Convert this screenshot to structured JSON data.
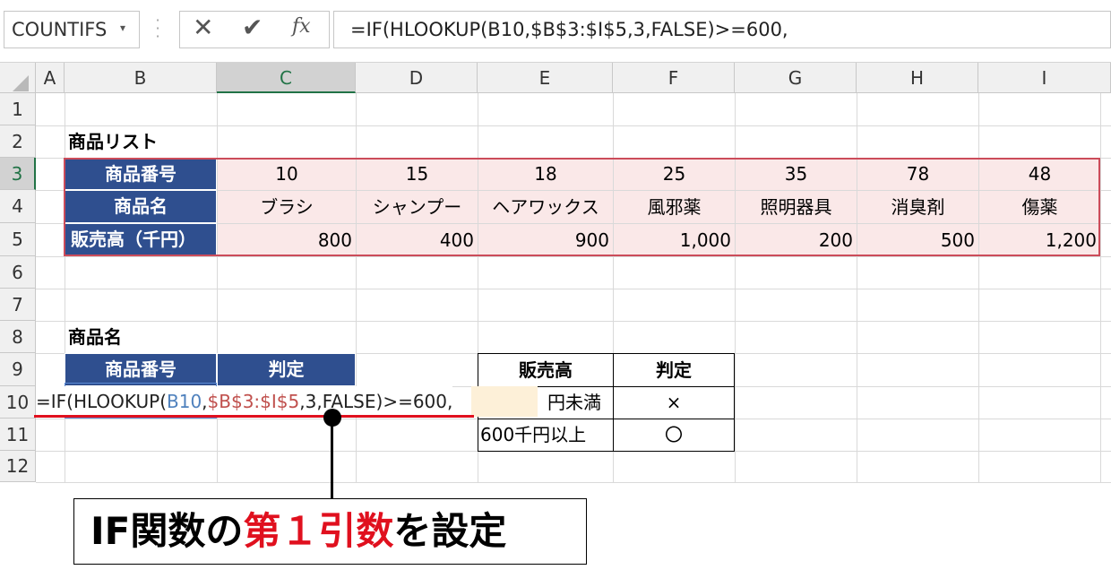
{
  "namebox": {
    "value": "COUNTIFS",
    "arrow": "▾"
  },
  "formula_bar": {
    "cancel_icon": "✕",
    "enter_icon": "✔",
    "fx_icon": "fx",
    "formula": "=IF(HLOOKUP(B10,$B$3:$I$5,3,FALSE)>=600,"
  },
  "columns": [
    "A",
    "B",
    "C",
    "D",
    "E",
    "F",
    "G",
    "H",
    "I"
  ],
  "rows": [
    "1",
    "2",
    "3",
    "4",
    "5",
    "6",
    "7",
    "8",
    "9",
    "10",
    "11",
    "12"
  ],
  "product_list": {
    "title": "商品リスト",
    "row_labels": [
      "商品番号",
      "商品名",
      "販売高（千円）"
    ],
    "numbers": [
      "10",
      "15",
      "18",
      "25",
      "35",
      "78",
      "48"
    ],
    "names": [
      "ブラシ",
      "シャンプー",
      "ヘアワックス",
      "風邪薬",
      "照明器具",
      "消臭剤",
      "傷薬"
    ],
    "sales": [
      "800",
      "400",
      "900",
      "1,000",
      "200",
      "500",
      "1,200"
    ]
  },
  "lookup": {
    "title": "商品名",
    "header_number": "商品番号",
    "header_judge": "判定"
  },
  "criteria": {
    "header_sales": "販売高",
    "header_judge": "判定",
    "row1_label": "円未満",
    "row1_mark": "×",
    "row2_label": "600千円以上",
    "row2_mark": "〇"
  },
  "edit_formula": {
    "p1": "=IF(HLOOKUP(",
    "p2": "B10",
    "p3": ",",
    "p4": "$B$3:$I$5",
    "p5": ",3,FALSE)>=600,"
  },
  "callout": {
    "part1": "IF関数の",
    "part2": "第１引数",
    "part3": "を設定"
  }
}
